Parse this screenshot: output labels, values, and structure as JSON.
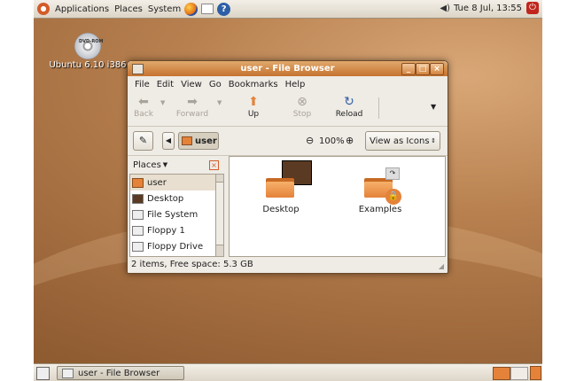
{
  "top_panel": {
    "menus": [
      "Applications",
      "Places",
      "System"
    ],
    "clock": "Tue  8 Jul, 13:55"
  },
  "desktop": {
    "dvd_icon_text": "DVD-ROM",
    "dvd_label": "Ubuntu 6.10 i386"
  },
  "window": {
    "title": "user - File Browser",
    "menu": [
      "File",
      "Edit",
      "View",
      "Go",
      "Bookmarks",
      "Help"
    ],
    "toolbar": {
      "back": "Back",
      "forward": "Forward",
      "up": "Up",
      "stop": "Stop",
      "reload": "Reload"
    },
    "location": {
      "path_button": "user",
      "zoom": "100%",
      "view_mode": "View as Icons"
    },
    "sidebar": {
      "header": "Places",
      "items": [
        "user",
        "Desktop",
        "File System",
        "Floppy 1",
        "Floppy Drive"
      ]
    },
    "files": [
      {
        "name": "Desktop"
      },
      {
        "name": "Examples"
      }
    ],
    "status": "2 items, Free space: 5.3 GB"
  },
  "bottom_panel": {
    "task": "user - File Browser"
  },
  "colors": {
    "accent": "#e4823a",
    "title_bar": "#c6722f",
    "desktop": "#b8804f"
  }
}
